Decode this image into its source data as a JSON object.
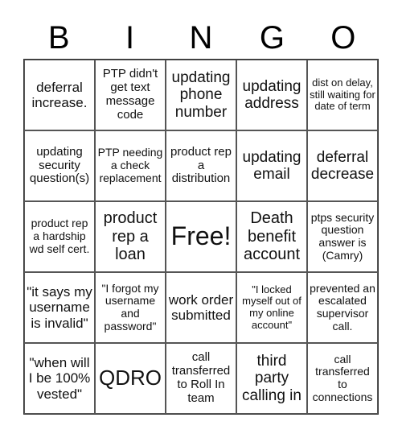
{
  "title_letters": [
    "B",
    "I",
    "N",
    "G",
    "O"
  ],
  "cells": [
    [
      "deferral increase.",
      "PTP didn't get text message code",
      "updating phone number",
      "updating address",
      "dist on delay, still waiting for date of term"
    ],
    [
      "updating security question(s)",
      "PTP needing a check replacement",
      "product rep a distribution",
      "updating email",
      "deferral decrease"
    ],
    [
      "product rep a hardship wd self cert.",
      "product rep a loan",
      "Free!",
      "Death benefit account",
      "ptps security question answer is (Camry)"
    ],
    [
      "\"it says my username is invalid\"",
      "\"I forgot my username and password\"",
      "work order submitted",
      "\"I locked myself out of my online account\"",
      "prevented an escalated supervisor call."
    ],
    [
      "\"when will I be 100% vested\"",
      "QDRO",
      "call transferred to Roll In team",
      "third party calling in",
      "call transferred to connections"
    ]
  ]
}
